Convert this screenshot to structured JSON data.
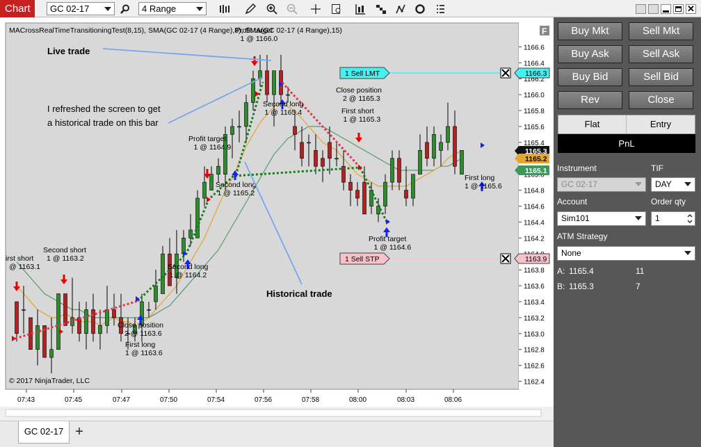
{
  "window": {
    "tab_label": "Chart"
  },
  "toolbar": {
    "instrument": "GC 02-17",
    "bar_type": "4 Range"
  },
  "chart": {
    "indicator_label": "MACrossRealTimeTransitioningTest(8,15), SMA(GC 02-17 (4 Range),8), SMA(GC 02-17 (4 Range),15)",
    "copyright": "© 2017 NinjaTrader, LLC",
    "y_ticks": [
      "1166.6",
      "1166.4",
      "1166.2",
      "1166.0",
      "1165.8",
      "1165.6",
      "1165.4",
      "1165.2",
      "1165.0",
      "1164.8",
      "1164.6",
      "1164.4",
      "1164.2",
      "1164.0",
      "1163.8",
      "1163.6",
      "1163.4",
      "1163.2",
      "1163.0",
      "1162.8",
      "1162.6",
      "1162.4"
    ],
    "x_ticks": [
      "07:43",
      "07:45",
      "07:47",
      "07:50",
      "07:54",
      "07:56",
      "07:58",
      "08:00",
      "08:03",
      "08:06"
    ],
    "price_tags": {
      "ask": "1165.3",
      "current": "1165.2",
      "bid": "1165.1",
      "limit": "1166.3",
      "stop": "1163.9"
    },
    "orders": {
      "limit": "1  Sell LMT",
      "stop": "1  Sell STP"
    },
    "annotations": {
      "live": "Live trade",
      "refresh_1": "I refreshed the screen to get",
      "refresh_2": "a historical trade on this bar",
      "historical": "Historical trade"
    },
    "labels": [
      {
        "l1": "irst short",
        "l2": "@ 1163.1"
      },
      {
        "l1": "Second short",
        "l2": "1 @ 1163.2"
      },
      {
        "l1": "Close position",
        "l2": "2 @ 1163.6"
      },
      {
        "l1": "First long",
        "l2": "1 @ 1163.6"
      },
      {
        "l1": "Second long",
        "l2": "1 @ 1164.2"
      },
      {
        "l1": "Profit target",
        "l2": "1 @ 1164.9"
      },
      {
        "l1": "Second long",
        "l2": "1 @ 1165.2"
      },
      {
        "l1": "Profit target",
        "l2": "1 @ 1166.0"
      },
      {
        "l1": "Second long",
        "l2": "1 @ 1165.4"
      },
      {
        "l1": "Close position",
        "l2": "2 @ 1165.3"
      },
      {
        "l1": "First short",
        "l2": "1 @ 1165.3"
      },
      {
        "l1": "Profit target",
        "l2": "1 @ 1164.6"
      },
      {
        "l1": "First long",
        "l2": "1 @ 1165.6"
      }
    ]
  },
  "chart_data": {
    "type": "candlestick",
    "ylim": [
      1162.3,
      1166.9
    ],
    "bars": [
      [
        1163.4,
        1163.4,
        1162.9,
        1163.0
      ],
      [
        1163.3,
        1163.6,
        1163.0,
        1163.3
      ],
      [
        1163.2,
        1163.2,
        1162.8,
        1162.8
      ],
      [
        1162.8,
        1163.3,
        1162.6,
        1163.1
      ],
      [
        1163.1,
        1163.1,
        1162.7,
        1162.7
      ],
      [
        1162.7,
        1163.2,
        1162.5,
        1162.8
      ],
      [
        1162.8,
        1163.5,
        1162.8,
        1163.5
      ],
      [
        1163.5,
        1163.5,
        1163.1,
        1163.1
      ],
      [
        1163.1,
        1163.7,
        1163.0,
        1163.2
      ],
      [
        1163.2,
        1163.4,
        1162.9,
        1163.0
      ],
      [
        1163.0,
        1163.4,
        1162.8,
        1163.3
      ],
      [
        1163.3,
        1163.5,
        1162.9,
        1163.0
      ],
      [
        1163.0,
        1163.3,
        1162.8,
        1163.1
      ],
      [
        1163.1,
        1163.6,
        1163.0,
        1163.3
      ],
      [
        1163.3,
        1163.5,
        1163.1,
        1163.2
      ],
      [
        1163.2,
        1163.5,
        1162.9,
        1163.0
      ],
      [
        1163.0,
        1163.2,
        1162.8,
        1163.0
      ],
      [
        1163.0,
        1163.2,
        1162.9,
        1163.1
      ],
      [
        1163.1,
        1163.5,
        1162.9,
        1163.4
      ],
      [
        1163.3,
        1163.4,
        1163.2,
        1163.3
      ],
      [
        1163.4,
        1163.8,
        1163.3,
        1163.6
      ],
      [
        1163.5,
        1164.1,
        1163.5,
        1164.0
      ],
      [
        1164.0,
        1164.2,
        1163.6,
        1163.6
      ],
      [
        1163.7,
        1164.3,
        1163.5,
        1164.0
      ],
      [
        1164.0,
        1164.3,
        1163.9,
        1164.2
      ],
      [
        1164.2,
        1164.5,
        1164.1,
        1164.3
      ],
      [
        1164.2,
        1164.8,
        1164.2,
        1164.7
      ],
      [
        1164.7,
        1165.1,
        1164.6,
        1164.9
      ],
      [
        1164.8,
        1165.1,
        1164.8,
        1165.0
      ],
      [
        1165.0,
        1165.2,
        1164.9,
        1165.1
      ],
      [
        1165.0,
        1165.6,
        1164.8,
        1165.5
      ],
      [
        1165.5,
        1165.7,
        1165.2,
        1165.6
      ],
      [
        1165.6,
        1165.8,
        1165.4,
        1165.6
      ],
      [
        1165.6,
        1166.0,
        1165.4,
        1165.9
      ],
      [
        1165.9,
        1166.3,
        1165.8,
        1166.2
      ],
      [
        1166.2,
        1166.5,
        1166.1,
        1166.3
      ],
      [
        1166.3,
        1166.5,
        1165.9,
        1166.0
      ],
      [
        1166.0,
        1166.3,
        1165.6,
        1166.3
      ],
      [
        1166.3,
        1166.5,
        1165.9,
        1166.0
      ],
      [
        1166.0,
        1166.1,
        1165.9,
        1166.0
      ],
      [
        1165.6,
        1165.8,
        1165.3,
        1165.5
      ],
      [
        1165.4,
        1165.6,
        1165.1,
        1165.2
      ],
      [
        1165.4,
        1165.5,
        1165.1,
        1165.4
      ],
      [
        1165.3,
        1165.5,
        1165.0,
        1165.1
      ],
      [
        1165.2,
        1165.3,
        1164.9,
        1165.1
      ],
      [
        1165.4,
        1165.6,
        1165.0,
        1165.2
      ],
      [
        1165.2,
        1165.4,
        1165.1,
        1165.2
      ],
      [
        1165.1,
        1165.3,
        1164.8,
        1164.9
      ],
      [
        1164.9,
        1165.0,
        1164.6,
        1164.8
      ],
      [
        1164.8,
        1164.9,
        1164.6,
        1164.7
      ],
      [
        1164.9,
        1165.1,
        1164.5,
        1164.5
      ],
      [
        1164.6,
        1164.9,
        1164.5,
        1164.8
      ],
      [
        1164.5,
        1164.7,
        1164.4,
        1164.6
      ],
      [
        1164.6,
        1165.0,
        1164.5,
        1164.9
      ],
      [
        1164.9,
        1165.3,
        1164.8,
        1165.2
      ],
      [
        1165.2,
        1165.3,
        1164.8,
        1164.9
      ],
      [
        1164.8,
        1165.1,
        1164.6,
        1164.7
      ],
      [
        1164.7,
        1165.0,
        1164.6,
        1165.0
      ],
      [
        1165.0,
        1165.5,
        1165.0,
        1165.3
      ],
      [
        1165.4,
        1165.6,
        1165.1,
        1165.2
      ],
      [
        1165.2,
        1165.6,
        1165.1,
        1165.5
      ],
      [
        1165.3,
        1165.5,
        1165.1,
        1165.4
      ],
      [
        1165.4,
        1165.9,
        1165.3,
        1165.6
      ],
      [
        1165.6,
        1165.8,
        1165.0,
        1165.1
      ],
      [
        1165.0,
        1165.3,
        1165.0,
        1165.3
      ]
    ],
    "sma8": [
      1163.6,
      1163.5,
      1163.4,
      1163.3,
      1163.25,
      1163.2,
      1163.2,
      1163.25,
      1163.2,
      1163.15,
      1163.15,
      1163.15,
      1163.1,
      1163.15,
      1163.2,
      1163.15,
      1163.15,
      1163.1,
      1163.15,
      1163.2,
      1163.3,
      1163.4,
      1163.5,
      1163.6,
      1163.75,
      1163.9,
      1164.05,
      1164.2,
      1164.4,
      1164.6,
      1164.8,
      1164.95,
      1165.15,
      1165.35,
      1165.5,
      1165.65,
      1165.75,
      1165.85,
      1165.9,
      1165.85,
      1165.8,
      1165.7,
      1165.6,
      1165.5,
      1165.4,
      1165.35,
      1165.3,
      1165.2,
      1165.1,
      1165.0,
      1164.95,
      1164.9,
      1164.85,
      1164.85,
      1164.85,
      1164.85,
      1164.85,
      1164.9,
      1164.95,
      1165.0,
      1165.05,
      1165.1,
      1165.2,
      1165.25,
      1165.3
    ],
    "sma15": [
      1163.9,
      1163.8,
      1163.7,
      1163.6,
      1163.5,
      1163.45,
      1163.4,
      1163.35,
      1163.3,
      1163.3,
      1163.25,
      1163.2,
      1163.2,
      1163.2,
      1163.2,
      1163.2,
      1163.2,
      1163.2,
      1163.2,
      1163.2,
      1163.25,
      1163.3,
      1163.35,
      1163.45,
      1163.55,
      1163.65,
      1163.75,
      1163.85,
      1163.95,
      1164.05,
      1164.2,
      1164.35,
      1164.5,
      1164.65,
      1164.8,
      1164.95,
      1165.1,
      1165.25,
      1165.35,
      1165.45,
      1165.5,
      1165.55,
      1165.6,
      1165.6,
      1165.6,
      1165.55,
      1165.5,
      1165.45,
      1165.4,
      1165.35,
      1165.3,
      1165.25,
      1165.2,
      1165.15,
      1165.1,
      1165.05,
      1165.05,
      1165.05,
      1165.05,
      1165.05,
      1165.05,
      1165.1,
      1165.1,
      1165.15,
      1165.2
    ],
    "markers": [
      {
        "bar": 1,
        "dir": "down",
        "label": 0
      },
      {
        "bar": 11,
        "dir": "down",
        "label": 1
      },
      {
        "bar": 21,
        "dir": "up",
        "label": 2
      },
      {
        "bar": 28,
        "dir": "up",
        "label": 4
      },
      {
        "bar": 32,
        "dir": "down",
        "label": 5
      },
      {
        "bar": 37,
        "dir": "up",
        "label": 6
      },
      {
        "bar": 42,
        "dir": "down",
        "label": 7
      },
      {
        "bar": 45,
        "dir": "up",
        "label": 8
      },
      {
        "bar": 56,
        "dir": "down",
        "label": 10
      },
      {
        "bar": 60,
        "dir": "up",
        "label": 11
      },
      {
        "bar": 69,
        "dir": "up",
        "label": 12
      }
    ]
  },
  "panel": {
    "buttons": [
      "Buy Mkt",
      "Sell Mkt",
      "Buy Ask",
      "Sell Ask",
      "Buy Bid",
      "Sell Bid",
      "Rev",
      "Close"
    ],
    "flat": "Flat",
    "entry": "Entry",
    "pnl": "PnL",
    "instrument_label": "Instrument",
    "instrument": "GC 02-17",
    "tif_label": "TIF",
    "tif": "DAY",
    "account_label": "Account",
    "account": "Sim101",
    "qty_label": "Order qty",
    "qty": "1",
    "atm_label": "ATM Strategy",
    "atm": "None",
    "ask_label": "A:",
    "ask_price": "1165.4",
    "ask_size": "11",
    "bid_label": "B:",
    "bid_price": "1165.3",
    "bid_size": "7"
  },
  "bottom": {
    "tab": "GC 02-17",
    "add": "+"
  }
}
